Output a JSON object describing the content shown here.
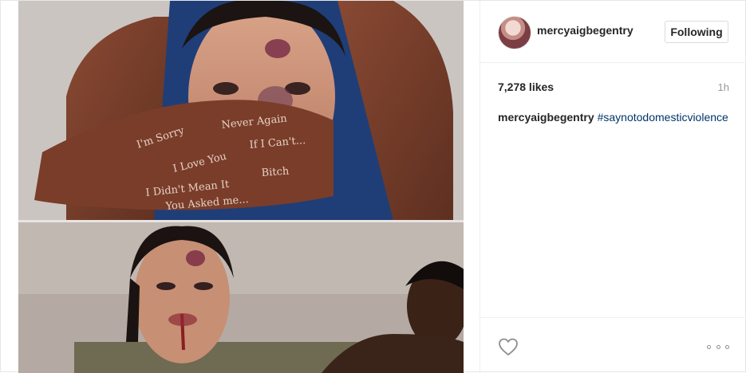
{
  "post": {
    "image_description": "",
    "header": {
      "username": "mercyaigbegentry",
      "follow_button_label": "Following"
    },
    "stats": {
      "likes": "7,278 likes",
      "time": "1h"
    },
    "caption": {
      "username": "mercyaigbegentry",
      "text": "#saynotodomesticviolence"
    },
    "hand_writing": [
      "I'm Sorry",
      "Never Again",
      "I Love You",
      "If I Can't...",
      "I Didn't Mean It",
      "Bitch",
      "You Asked me..."
    ],
    "icons": {
      "like": "heart-icon",
      "more": "more-options-icon",
      "avatar": "avatar"
    }
  }
}
